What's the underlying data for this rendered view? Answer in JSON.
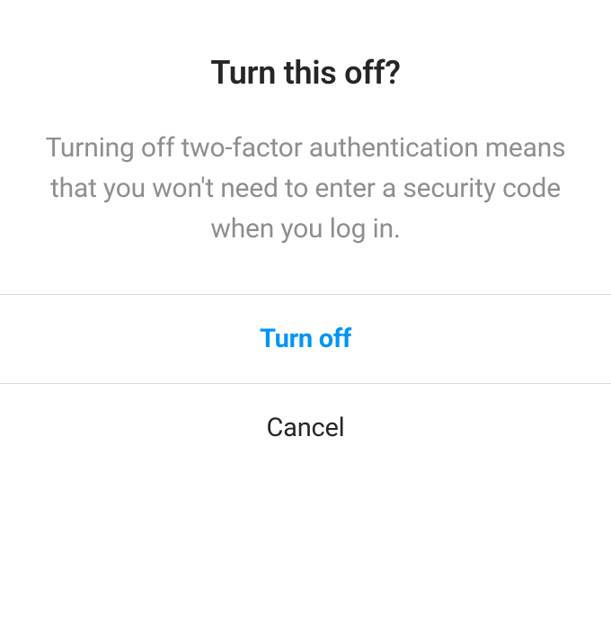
{
  "dialog": {
    "title": "Turn this off?",
    "body": "Turning off two-factor authentica­tion means that you won't need to enter a security code when you log in.",
    "primary_action_label": "Turn off",
    "secondary_action_label": "Cancel"
  }
}
